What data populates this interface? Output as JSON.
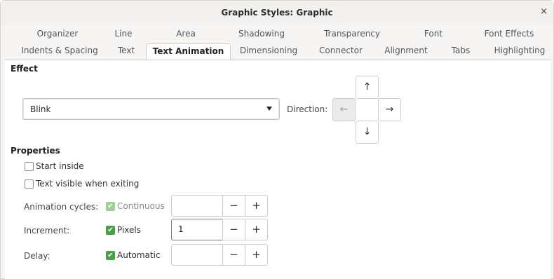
{
  "window": {
    "title": "Graphic Styles: Graphic",
    "close_glyph": "×"
  },
  "tabs_row1": [
    "Organizer",
    "Line",
    "Area",
    "Shadowing",
    "Transparency",
    "Font",
    "Font Effects"
  ],
  "tabs_row2": [
    "Indents & Spacing",
    "Text",
    "Text Animation",
    "Dimensioning",
    "Connector",
    "Alignment",
    "Tabs",
    "Highlighting"
  ],
  "active_tab": "Text Animation",
  "effect": {
    "section_title": "Effect",
    "selected": "Blink",
    "direction_label": "Direction:",
    "direction_glyphs": {
      "up": "↑",
      "left": "←",
      "right": "→",
      "down": "↓"
    }
  },
  "properties": {
    "section_title": "Properties",
    "start_inside": "Start inside",
    "text_visible": "Text visible when exiting",
    "animation_cycles": {
      "label": "Animation cycles:",
      "check_label": "Continuous",
      "value": ""
    },
    "increment": {
      "label": "Increment:",
      "check_label": "Pixels",
      "value": "1"
    },
    "delay": {
      "label": "Delay:",
      "check_label": "Automatic",
      "value": ""
    }
  },
  "spin_glyphs": {
    "minus": "−",
    "plus": "+"
  },
  "check_glyph": "✔",
  "colors": {
    "check_green": "#4aa048",
    "check_green_dim": "#9ed09a"
  },
  "icons": {
    "up": "arrow-up-icon",
    "left": "arrow-left-icon",
    "right": "arrow-right-icon",
    "down": "arrow-down-icon",
    "close": "close-icon",
    "dropdown": "chevron-down-icon",
    "check": "checkmark-icon"
  }
}
